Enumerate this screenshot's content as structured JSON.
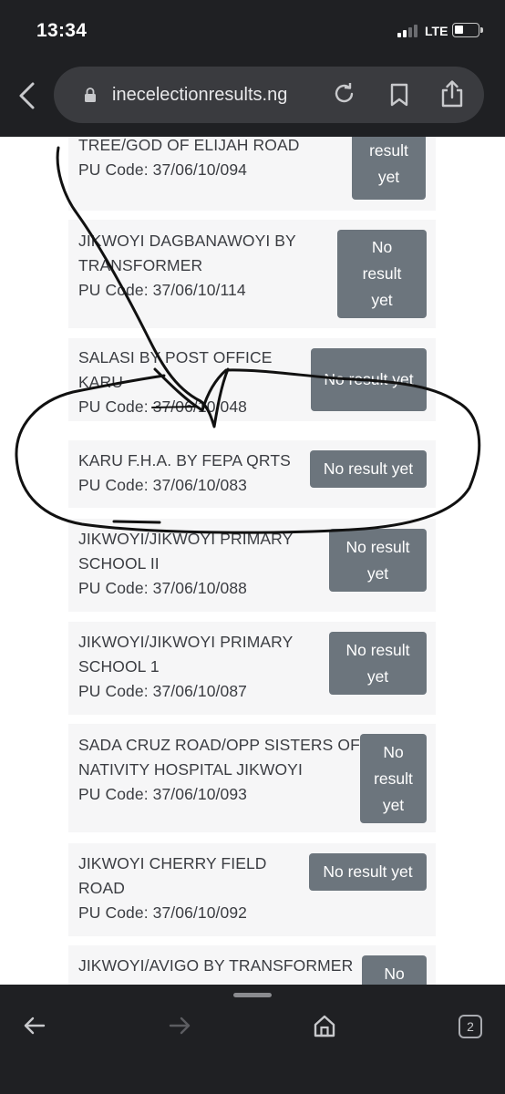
{
  "status_bar": {
    "time": "13:34",
    "network": "LTE",
    "signal_bars": 2
  },
  "browser": {
    "url": "inecelectionresults.ng",
    "tab_count": "2"
  },
  "polling_units": [
    {
      "name": "TREE/GOD OF ELIJAH ROAD",
      "code": "PU Code: 37/06/10/094",
      "status": "result yet"
    },
    {
      "name": "JIKWOYI DAGBANAWOYI BY TRANSFORMER",
      "code": "PU Code: 37/06/10/114",
      "status": "No result yet"
    },
    {
      "name": "SALASI BY POST OFFICE KARU",
      "code": "PU Code: 37/06/10/048",
      "status": "No result yet"
    },
    {
      "name": "KARU F.H.A. BY FEPA QRTS",
      "code": "PU Code: 37/06/10/083",
      "status": "No result yet"
    },
    {
      "name": "JIKWOYI/JIKWOYI PRIMARY SCHOOL II",
      "code": "PU Code: 37/06/10/088",
      "status": "No result yet"
    },
    {
      "name": "JIKWOYI/JIKWOYI PRIMARY SCHOOL 1",
      "code": "PU Code: 37/06/10/087",
      "status": "No result yet"
    },
    {
      "name": "SADA CRUZ ROAD/OPP SISTERS OF NATIVITY HOSPITAL JIKWOYI",
      "code": "PU Code: 37/06/10/093",
      "status": "No result yet"
    },
    {
      "name": "JIKWOYI CHERRY FIELD ROAD",
      "code": "PU Code: 37/06/10/092",
      "status": "No result yet"
    },
    {
      "name": "JIKWOYI/AVIGO BY TRANSFORMER",
      "code": "",
      "status": "No"
    }
  ],
  "colors": {
    "chrome": "#1f2023",
    "urlbar": "#3a3b3f",
    "card": "#f6f6f7",
    "badge": "#6c757d",
    "text": "#3b3d42"
  }
}
